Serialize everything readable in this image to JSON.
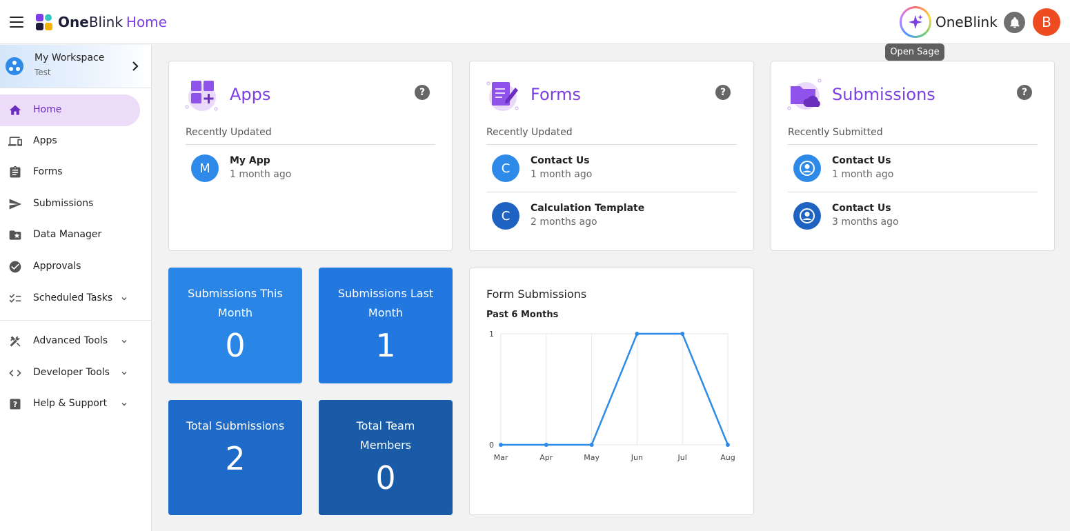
{
  "header": {
    "brand_bold": "One",
    "brand_regular": "Blink",
    "brand_accent": "Home",
    "sage_label": "OneBlink",
    "tooltip": "Open Sage",
    "avatar_initial": "B",
    "avatar_color": "#ef4b20"
  },
  "workspace": {
    "name": "My Workspace",
    "sub": "Test"
  },
  "sidebar": {
    "items": [
      {
        "label": "Home",
        "icon": "home-icon"
      },
      {
        "label": "Apps",
        "icon": "devices-icon"
      },
      {
        "label": "Forms",
        "icon": "clipboard-icon"
      },
      {
        "label": "Submissions",
        "icon": "send-icon"
      },
      {
        "label": "Data Manager",
        "icon": "folder-star-icon"
      },
      {
        "label": "Approvals",
        "icon": "check-circle-icon"
      },
      {
        "label": "Scheduled Tasks",
        "icon": "checklist-icon"
      },
      {
        "label": "Advanced Tools",
        "icon": "tools-icon"
      },
      {
        "label": "Developer Tools",
        "icon": "code-icon"
      },
      {
        "label": "Help & Support",
        "icon": "help-box-icon"
      }
    ]
  },
  "cards": {
    "apps": {
      "title": "Apps",
      "subtitle": "Recently Updated",
      "items": [
        {
          "initial": "M",
          "title": "My App",
          "time": "1 month ago"
        }
      ]
    },
    "forms": {
      "title": "Forms",
      "subtitle": "Recently Updated",
      "items": [
        {
          "initial": "C",
          "title": "Contact Us",
          "time": "1 month ago"
        },
        {
          "initial": "C",
          "title": "Calculation Template",
          "time": "2 months ago"
        }
      ]
    },
    "submissions": {
      "title": "Submissions",
      "subtitle": "Recently Submitted",
      "items": [
        {
          "title": "Contact Us",
          "time": "1 month ago"
        },
        {
          "title": "Contact Us",
          "time": "3 months ago"
        }
      ]
    }
  },
  "stats": [
    {
      "label": "Submissions This Month",
      "value": "0",
      "color": "#2a86e6"
    },
    {
      "label": "Submissions Last Month",
      "value": "1",
      "color": "#2278df"
    },
    {
      "label": "Total Submissions",
      "value": "2",
      "color": "#1d6ac8"
    },
    {
      "label": "Total Team Members",
      "value": "0",
      "color": "#1a5ba8"
    }
  ],
  "chart_title": "Form Submissions",
  "chart_data": {
    "type": "line",
    "title": "Past 6 Months",
    "x": [
      "Mar",
      "Apr",
      "May",
      "Jun",
      "Jul",
      "Aug"
    ],
    "series": [
      {
        "values": [
          0,
          0,
          0,
          1,
          1,
          0
        ]
      }
    ],
    "ylim": [
      0,
      1
    ],
    "yticks": [
      0,
      1
    ],
    "grid": true,
    "line_color": "#2d8ae8"
  }
}
